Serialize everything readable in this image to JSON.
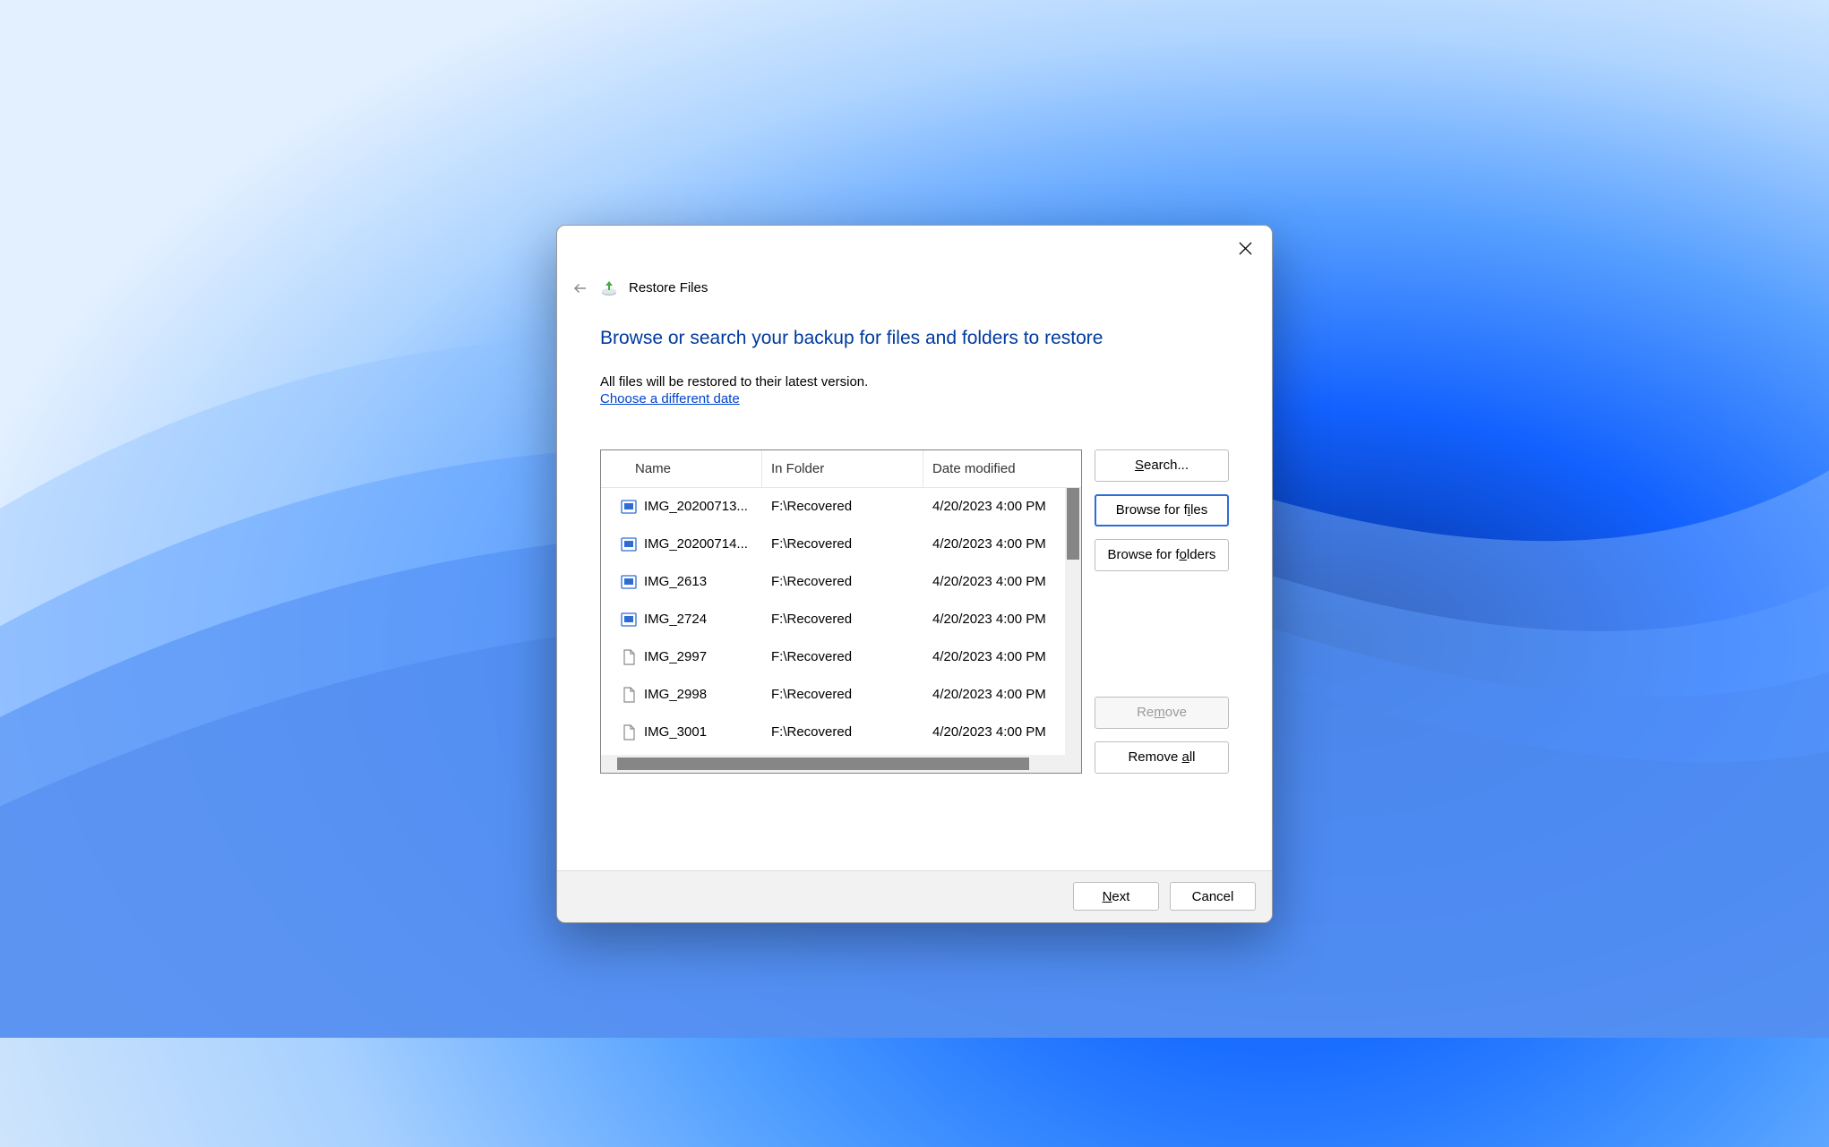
{
  "window": {
    "title": "Restore Files"
  },
  "heading": "Browse or search your backup for files and folders to restore",
  "subtext": "All files will be restored to their latest version.",
  "link": "Choose a different date",
  "columns": {
    "name": "Name",
    "folder": "In Folder",
    "date": "Date modified"
  },
  "files": [
    {
      "icon": "image",
      "name": "IMG_20200713...",
      "folder": "F:\\Recovered",
      "date": "4/20/2023 4:00 PM"
    },
    {
      "icon": "image",
      "name": "IMG_20200714...",
      "folder": "F:\\Recovered",
      "date": "4/20/2023 4:00 PM"
    },
    {
      "icon": "image",
      "name": "IMG_2613",
      "folder": "F:\\Recovered",
      "date": "4/20/2023 4:00 PM"
    },
    {
      "icon": "image",
      "name": "IMG_2724",
      "folder": "F:\\Recovered",
      "date": "4/20/2023 4:00 PM"
    },
    {
      "icon": "doc",
      "name": "IMG_2997",
      "folder": "F:\\Recovered",
      "date": "4/20/2023 4:00 PM"
    },
    {
      "icon": "doc",
      "name": "IMG_2998",
      "folder": "F:\\Recovered",
      "date": "4/20/2023 4:00 PM"
    },
    {
      "icon": "doc",
      "name": "IMG_3001",
      "folder": "F:\\Recovered",
      "date": "4/20/2023 4:00 PM"
    }
  ],
  "buttons": {
    "search": "Search...",
    "search_u": "S",
    "browse_files_pre": "Browse for f",
    "browse_files_u": "i",
    "browse_files_post": "les",
    "browse_folders_pre": "Browse for f",
    "browse_folders_u": "o",
    "browse_folders_post": "lders",
    "remove_pre": "Re",
    "remove_u": "m",
    "remove_post": "ove",
    "remove_all_pre": "Remove ",
    "remove_all_u": "a",
    "remove_all_post": "ll",
    "next_u": "N",
    "next_post": "ext",
    "cancel": "Cancel"
  }
}
